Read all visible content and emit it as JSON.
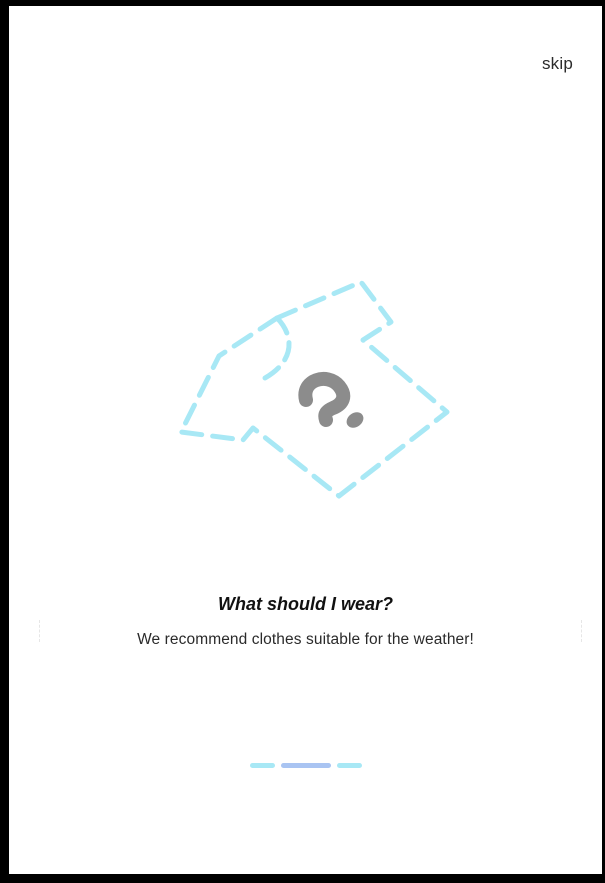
{
  "header": {
    "skip_label": "skip"
  },
  "onboarding": {
    "illustration_icon": "dashed-tshirt-question-icon",
    "title": "What should I wear?",
    "description": "We recommend clothes suitable for the weather!"
  },
  "pager": {
    "page_count": 3,
    "current_page": 2,
    "active_color": "#a9c4f2",
    "inactive_color": "#a8e8f5"
  },
  "colors": {
    "illustration_outline": "#a8e8f5",
    "question_mark": "#8c8c8c",
    "text_primary": "#111111"
  }
}
